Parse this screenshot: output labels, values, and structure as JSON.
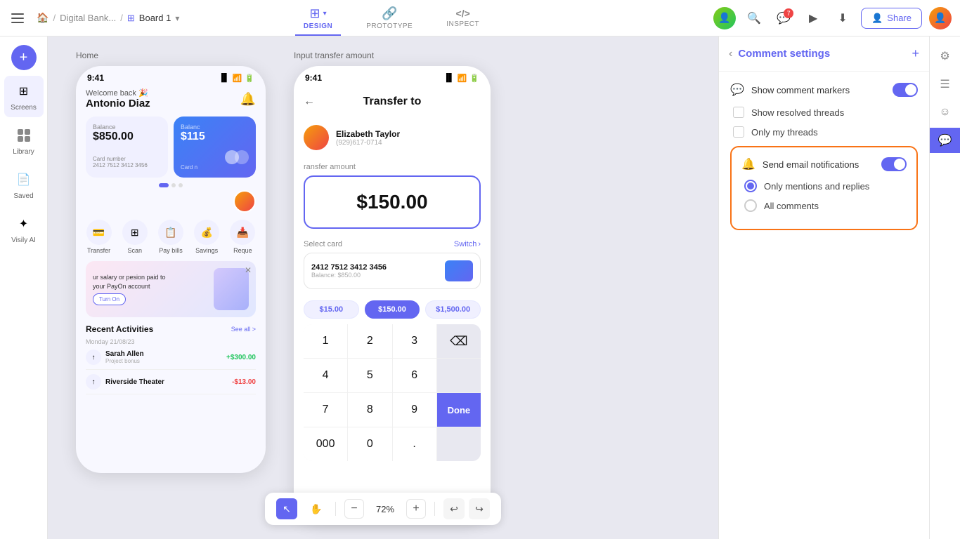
{
  "nav": {
    "breadcrumb": {
      "project": "Digital Bank...",
      "separator1": "/",
      "board": "Board 1",
      "chevron": "▾"
    },
    "tabs": [
      {
        "id": "design",
        "label": "DESIGN",
        "icon": "⊞",
        "active": true,
        "hasChevron": true
      },
      {
        "id": "prototype",
        "label": "PROTOTYPE",
        "icon": "🔗",
        "active": false
      },
      {
        "id": "inspect",
        "label": "INSPECT",
        "icon": "</>",
        "active": false
      }
    ],
    "right": {
      "comment_badge": "7",
      "share_label": "Share"
    }
  },
  "sidebar": {
    "items": [
      {
        "id": "screens",
        "label": "Screens",
        "icon": "⊞"
      },
      {
        "id": "library",
        "label": "Library",
        "icon": "🔲"
      },
      {
        "id": "saved",
        "label": "Saved",
        "icon": "📄"
      },
      {
        "id": "visily",
        "label": "Visily AI",
        "icon": "✦"
      }
    ],
    "add_btn": "+"
  },
  "canvas": {
    "screen1": {
      "label": "Home",
      "time": "9:41",
      "welcome": "Welcome back 🎉",
      "name": "Antonio Diaz",
      "balance1_label": "Balance",
      "balance1": "$850.00",
      "balance2_label": "Balanc",
      "balance2": "$115",
      "card_number": "2412 7512 3412 3456",
      "card_number2": "Card n",
      "actions": [
        "Transfer",
        "Scan",
        "Pay bills",
        "Savings",
        "Reque"
      ],
      "promo_text": "ur salary or pesion paid to your PayOn account",
      "promo_btn": "Turn On",
      "recent_title": "Recent Activities",
      "see_all": "See all >",
      "date": "Monday 21/08/23",
      "activities": [
        {
          "name": "Sarah Allen",
          "sub": "Project bonus",
          "amount": "+$300.00",
          "type": "pos"
        },
        {
          "name": "Riverside Theater",
          "sub": "",
          "amount": "-$13.00",
          "type": "neg"
        }
      ]
    },
    "screen2": {
      "label": "Input transfer amount",
      "time": "9:41",
      "title": "Transfer to",
      "recipient_name": "Elizabeth Taylor",
      "recipient_phone": "(929)617-0714",
      "transfer_label": "ransfer amount",
      "amount": "$150.00",
      "select_card_label": "Select card",
      "switch_label": "Switch",
      "card_num": "2412 7512 3412 3456",
      "card_balance": "Balance: $850.00",
      "quick_amounts": [
        "$15.00",
        "$150.00",
        "$1,500.00"
      ],
      "numpad": [
        "1",
        "2",
        "3",
        "⌫",
        "4",
        "5",
        "6",
        "",
        "7",
        "8",
        "9",
        "",
        "000",
        "0",
        ".",
        "Done"
      ],
      "zoom": "72%"
    }
  },
  "comment_panel": {
    "title": "Comment settings",
    "settings": [
      {
        "id": "show_markers",
        "label": "Show comment markers",
        "type": "toggle",
        "value": true,
        "icon": "💬"
      },
      {
        "id": "show_resolved",
        "label": "Show resolved threads",
        "type": "checkbox",
        "value": false
      },
      {
        "id": "only_my",
        "label": "Only my threads",
        "type": "checkbox",
        "value": false
      }
    ],
    "email_section": {
      "label": "Send email notifications",
      "toggle": true,
      "options": [
        {
          "id": "mentions",
          "label": "Only mentions and replies",
          "selected": true
        },
        {
          "id": "all",
          "label": "All comments",
          "selected": false
        }
      ]
    }
  },
  "far_right_toolbar": {
    "icons": [
      {
        "id": "settings",
        "symbol": "⚙",
        "active": false
      },
      {
        "id": "layers",
        "symbol": "☰",
        "active": false
      },
      {
        "id": "face",
        "symbol": "☺",
        "active": false
      },
      {
        "id": "comments",
        "symbol": "💬",
        "active": true
      }
    ]
  },
  "bottom_toolbar": {
    "zoom": "72%",
    "tools": [
      {
        "id": "select",
        "symbol": "↖",
        "active": true
      },
      {
        "id": "pan",
        "symbol": "✋",
        "active": false
      }
    ]
  }
}
